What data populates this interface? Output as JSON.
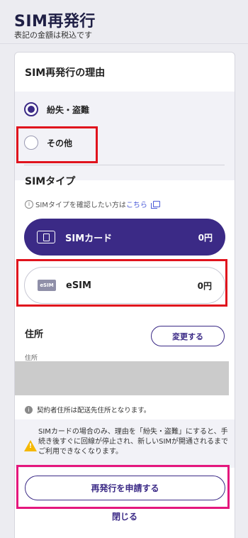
{
  "header": {
    "title": "SIM再発行",
    "subtitle": "表記の金額は税込です"
  },
  "reason": {
    "title": "SIM再発行の理由",
    "options": [
      {
        "label": "紛失・盗難",
        "checked": true
      },
      {
        "label": "その他",
        "checked": false
      }
    ]
  },
  "sim_type": {
    "title": "SIMタイプ",
    "info_text": "SIMタイプを確認したい方は",
    "info_link": "こちら",
    "options": [
      {
        "icon": "sim-card-icon",
        "name": "SIMカード",
        "price": "0円",
        "selected": true
      },
      {
        "icon": "esim-icon",
        "icon_text": "eSIM",
        "name": "eSIM",
        "price": "0円",
        "selected": false
      }
    ]
  },
  "address": {
    "title": "住所",
    "change_button": "変更する",
    "sub_label": "住所",
    "note": "契約者住所は配送先住所となります。"
  },
  "warning": {
    "text": "SIMカードの場合のみ、理由を「紛失・盗難」にすると、手続き後すぐに回線が停止され、新しいSIMが開通されるまでご利用できなくなります。"
  },
  "actions": {
    "apply_button": "再発行を申請する",
    "close_link": "閉じる"
  },
  "colors": {
    "primary": "#3b2a86",
    "highlight_red": "#e0131d",
    "highlight_pink": "#e4177d",
    "warning": "#f5b800",
    "link": "#4a5ad8"
  }
}
